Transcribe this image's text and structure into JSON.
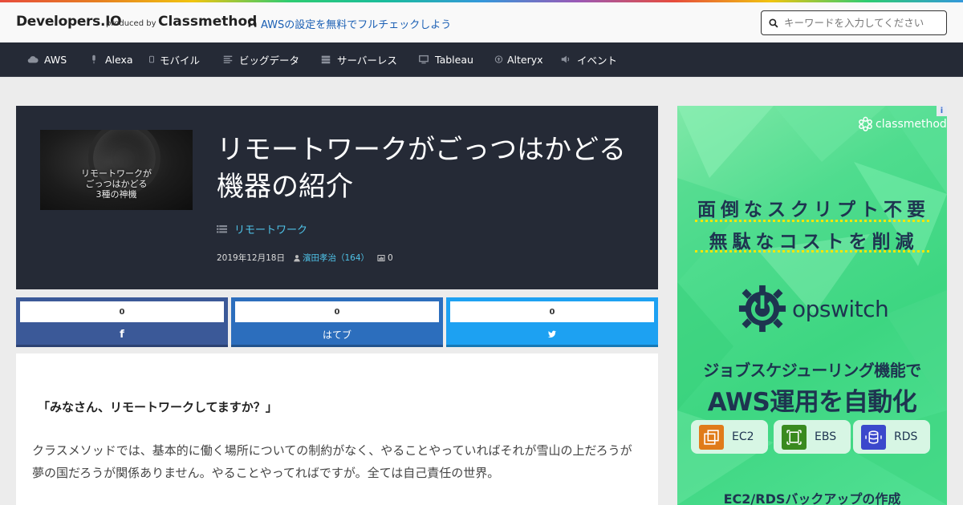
{
  "header": {
    "brand": "Developers.IO",
    "produced_by": "produced by",
    "company": "Classmethod",
    "promo_text": "AWSの設定を無料でフルチェックしよう",
    "search_placeholder": "キーワードを入力してください"
  },
  "nav": {
    "items": [
      {
        "label": "AWS",
        "icon": "cloud-icon"
      },
      {
        "label": "Alexa",
        "icon": "microphone-icon"
      },
      {
        "label": "モバイル",
        "icon": "mobile-icon"
      },
      {
        "label": "ビッグデータ",
        "icon": "list-icon"
      },
      {
        "label": "サーバーレス",
        "icon": "server-icon"
      },
      {
        "label": "Tableau",
        "icon": "desktop-icon"
      },
      {
        "label": "Alteryx",
        "icon": "arrow-circle-icon"
      },
      {
        "label": "イベント",
        "icon": "volume-icon"
      }
    ]
  },
  "article": {
    "thumbnail_text": [
      "リモートワークが",
      "ごっつはかどる",
      "3種の神機"
    ],
    "title_line1": "リモートワークがごっつはかどる",
    "title_line2": "機器の紹介",
    "tag": "リモートワーク",
    "date": "2019年12月18日",
    "author": "濱田孝治（164）",
    "view_count": "0",
    "lead": "「みなさん、リモートワークしてますか？」",
    "body": "クラスメソッドでは、基本的に働く場所についての制約がなく、やることやっていればそれが雪山の上だろうが夢の国だろうが関係ありません。やることやってればですが。全ては自己責任の世界。"
  },
  "share": {
    "facebook": {
      "count": "0",
      "label": "f",
      "color": "#3b5998"
    },
    "hatena": {
      "count": "0",
      "label": "はてブ",
      "color": "#2c6ebd"
    },
    "twitter": {
      "count": "0",
      "label": "",
      "color": "#1da1f2"
    }
  },
  "ad": {
    "info": "i",
    "logo_text": "classmethod",
    "headline1": "面倒なスクリプト不要",
    "headline2": "無駄なコストを削減",
    "product": "opswitch",
    "tagline1": "ジョブスケジューリング機能で",
    "tagline2": "AWS運用を自動化",
    "services": [
      "EC2",
      "EBS",
      "RDS"
    ],
    "footer": "EC2/RDSバックアップの作成"
  },
  "colors": {
    "nav_bg": "#252a36",
    "link": "#4fc3e8",
    "ad_green": "#3dd681",
    "ad_navy": "#1e3450"
  }
}
